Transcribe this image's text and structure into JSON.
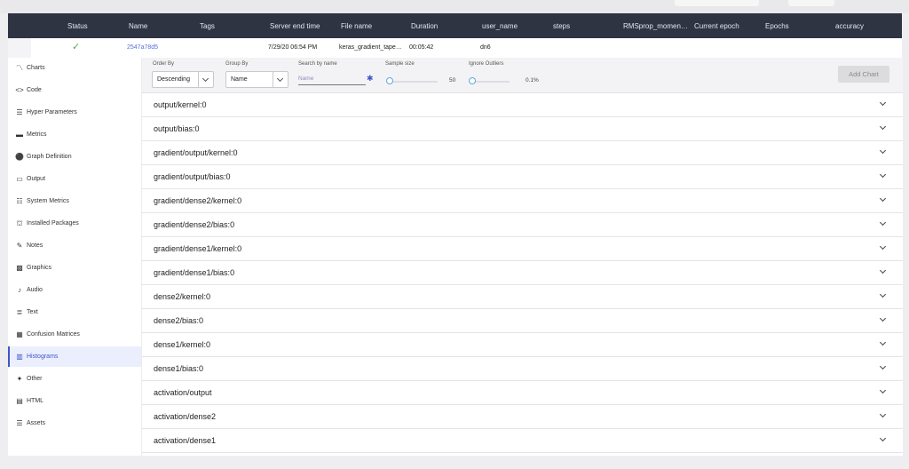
{
  "table": {
    "columns": [
      "Status",
      "Name",
      "Tags",
      "Server end time",
      "File name",
      "Duration",
      "user_name",
      "steps",
      "RMSprop_momen…",
      "Current epoch",
      "Epochs",
      "accuracy"
    ],
    "row": {
      "status_icon": "check-icon",
      "name": "2547a78d5",
      "tags": "",
      "server_end_time": "7/29/20 06:54 PM",
      "file_name": "keras_gradient_tape…",
      "duration": "00:05:42",
      "user_name": "dn6"
    }
  },
  "sidebar": {
    "items": [
      {
        "label": "Charts",
        "icon": "chart-line-icon"
      },
      {
        "label": "Code",
        "icon": "code-icon"
      },
      {
        "label": "Hyper Parameters",
        "icon": "list-icon"
      },
      {
        "label": "Metrics",
        "icon": "image-icon"
      },
      {
        "label": "Graph Definition",
        "icon": "graph-icon"
      },
      {
        "label": "Output",
        "icon": "laptop-icon"
      },
      {
        "label": "System Metrics",
        "icon": "server-icon"
      },
      {
        "label": "Installed Packages",
        "icon": "package-icon"
      },
      {
        "label": "Notes",
        "icon": "pencil-icon"
      },
      {
        "label": "Graphics",
        "icon": "picture-icon"
      },
      {
        "label": "Audio",
        "icon": "music-note-icon"
      },
      {
        "label": "Text",
        "icon": "text-icon"
      },
      {
        "label": "Confusion Matrices",
        "icon": "grid-icon"
      },
      {
        "label": "Histograms",
        "icon": "bar-chart-icon"
      },
      {
        "label": "Other",
        "icon": "puzzle-icon"
      },
      {
        "label": "HTML",
        "icon": "browser-icon"
      },
      {
        "label": "Assets",
        "icon": "list-icon"
      }
    ],
    "active": "Histograms"
  },
  "filters": {
    "order_by_label": "Order By",
    "order_by_value": "Descending",
    "group_by_label": "Group By",
    "group_by_value": "Name",
    "search_label": "Search by name",
    "search_placeholder": "Name",
    "sample_size_label": "Sample size",
    "sample_size_value": "50",
    "ignore_outliers_label": "Ignore Outliers",
    "ignore_outliers_value": "0.1%",
    "add_chart_label": "Add Chart"
  },
  "histograms": [
    "output/kernel:0",
    "output/bias:0",
    "gradient/output/kernel:0",
    "gradient/output/bias:0",
    "gradient/dense2/kernel:0",
    "gradient/dense2/bias:0",
    "gradient/dense1/kernel:0",
    "gradient/dense1/bias:0",
    "dense2/kernel:0",
    "dense2/bias:0",
    "dense1/kernel:0",
    "dense1/bias:0",
    "activation/output",
    "activation/dense2",
    "activation/dense1"
  ],
  "colors": {
    "header_bg": "#2f3443",
    "accent": "#3f55c9",
    "status_ok": "#4caf50"
  }
}
